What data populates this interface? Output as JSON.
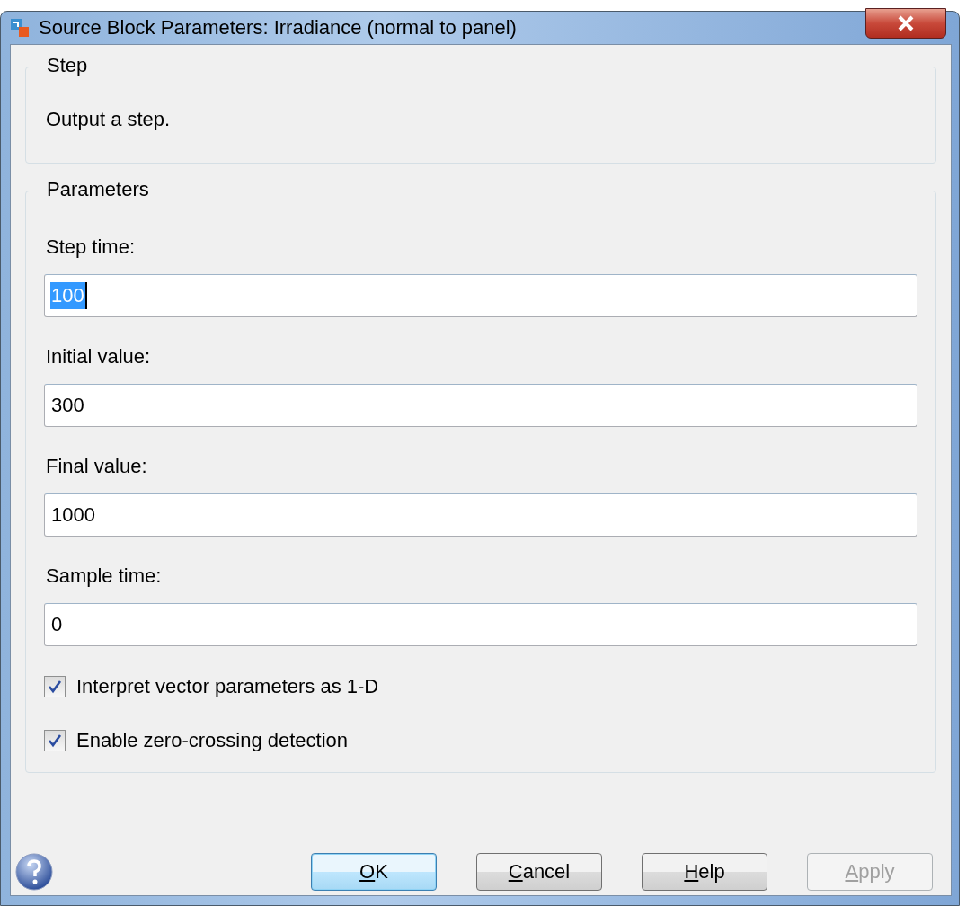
{
  "window": {
    "title": "Source Block Parameters: Irradiance (normal to panel)"
  },
  "description_group": {
    "title": "Step",
    "text": "Output a step."
  },
  "parameters_group": {
    "title": "Parameters",
    "fields": [
      {
        "label": "Step time:",
        "value": "100",
        "selected": true
      },
      {
        "label": "Initial value:",
        "value": "300",
        "selected": false
      },
      {
        "label": "Final value:",
        "value": "1000",
        "selected": false
      },
      {
        "label": "Sample time:",
        "value": "0",
        "selected": false
      }
    ],
    "checkboxes": [
      {
        "label": "Interpret vector parameters as 1-D",
        "checked": true
      },
      {
        "label": "Enable zero-crossing detection",
        "checked": true
      }
    ]
  },
  "buttons": [
    {
      "label": "OK",
      "default": true,
      "disabled": false
    },
    {
      "label": "Cancel",
      "default": false,
      "disabled": false
    },
    {
      "label": "Help",
      "default": false,
      "disabled": false
    },
    {
      "label": "Apply",
      "default": false,
      "disabled": true
    }
  ]
}
